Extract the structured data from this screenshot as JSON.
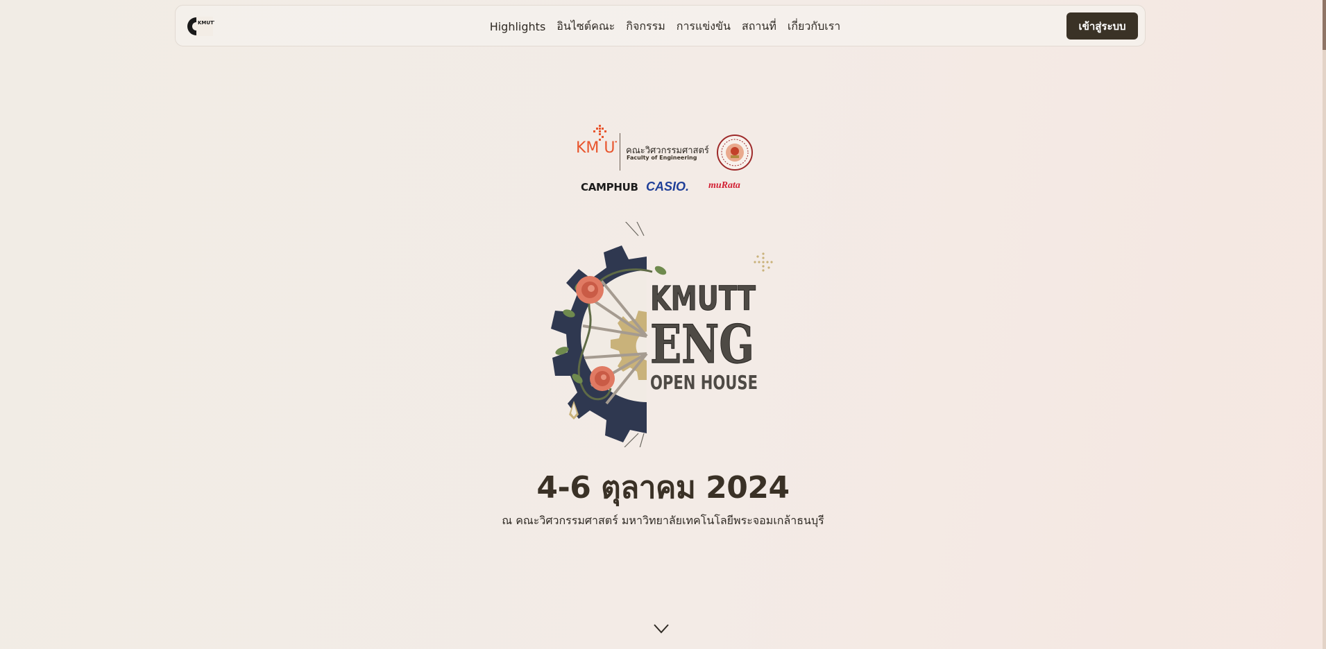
{
  "nav": {
    "logo_text": "KMUTT ENG",
    "links": [
      "Highlights",
      "อินไซต์คณะ",
      "กิจกรรม",
      "การแข่งขัน",
      "สถานที่",
      "เกี่ยวกับเรา"
    ],
    "login_label": "เข้าสู่ระบบ"
  },
  "sponsors": {
    "kmutt_logo_text": "KM UTT",
    "faculty_th": "คณะวิศวกรรมศาสตร์",
    "faculty_en": "Faculty of Engineering",
    "camphub": "CAMPHUB",
    "casio": "CASIO.",
    "murata": "muRata"
  },
  "hero": {
    "logo_line1": "KMUTT",
    "logo_line2": "ENG",
    "logo_line3": "OPEN HOUSE",
    "date": "4-6 ตุลาคม 2024",
    "venue": "ณ คณะวิศวกรรมศาสตร์ มหาวิทยาลัยเทคโนโลยีพระจอมเกล้าธนบุรี"
  },
  "colors": {
    "accent_dark": "#3a3226",
    "gear_navy": "#2f3850",
    "gear_gold": "#c9b27a",
    "rose": "#e07a63",
    "kmutt_orange": "#e8552d",
    "casio_blue": "#1f3f98",
    "murata_red": "#d21f33"
  },
  "icons": [
    "gear-icon",
    "chevron-down-icon"
  ]
}
